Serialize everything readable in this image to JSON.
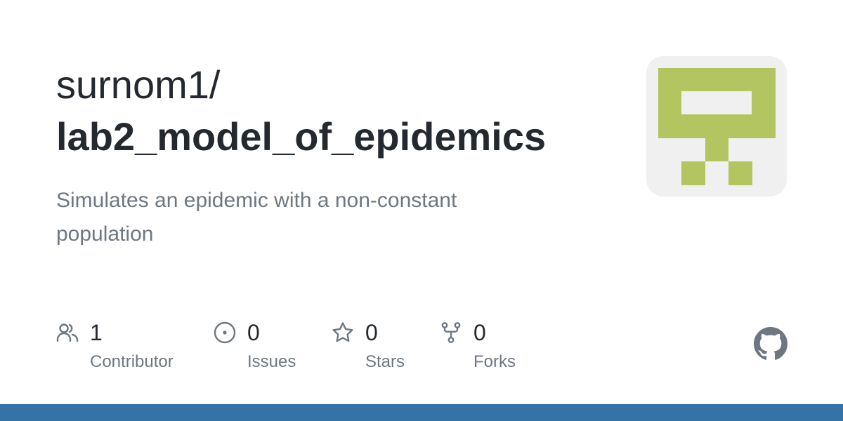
{
  "repo": {
    "owner": "surnom1/",
    "name": "lab2_model_of_epidemics",
    "description": "Simulates an epidemic with a non-constant population"
  },
  "stats": [
    {
      "icon": "people-icon",
      "value": "1",
      "label": "Contributor"
    },
    {
      "icon": "issue-icon",
      "value": "0",
      "label": "Issues"
    },
    {
      "icon": "star-icon",
      "value": "0",
      "label": "Stars"
    },
    {
      "icon": "fork-icon",
      "value": "0",
      "label": "Forks"
    }
  ],
  "colors": {
    "text_primary": "#24292f",
    "text_secondary": "#6e7781",
    "avatar_bg": "#f0f0f0",
    "avatar_fg": "#b2c561",
    "language_bar": "#3572a5"
  },
  "icons": {
    "avatar": "identicon",
    "brand": "github-icon"
  }
}
